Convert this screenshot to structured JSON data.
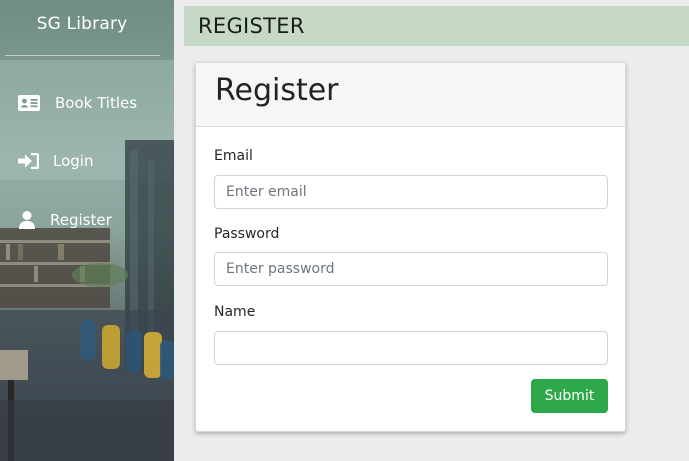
{
  "sidebar": {
    "title": "SG Library",
    "items": [
      {
        "label": "Book Titles",
        "icon": "id-card-icon"
      },
      {
        "label": "Login",
        "icon": "sign-in-icon"
      },
      {
        "label": "Register",
        "icon": "user-icon"
      }
    ]
  },
  "header": {
    "title": "REGISTER"
  },
  "form": {
    "title": "Register",
    "email": {
      "label": "Email",
      "placeholder": "Enter email",
      "value": ""
    },
    "password": {
      "label": "Password",
      "placeholder": "Enter password",
      "value": ""
    },
    "name": {
      "label": "Name",
      "placeholder": "",
      "value": ""
    },
    "submit_label": "Submit"
  },
  "colors": {
    "header_bg": "#c5d9c6",
    "submit_bg": "#2ea84a",
    "page_bg": "#ececec"
  }
}
